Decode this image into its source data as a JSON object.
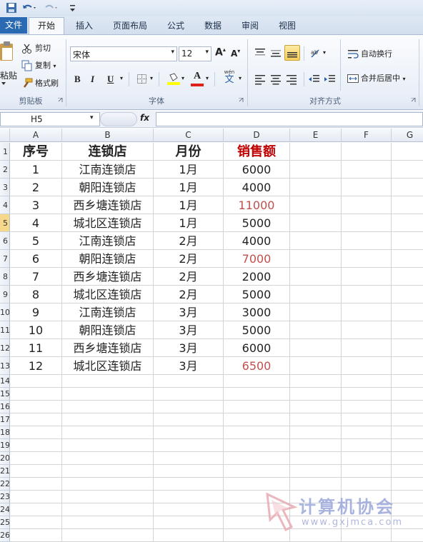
{
  "tabs": {
    "file": "文件",
    "home": "开始",
    "insert": "插入",
    "page_layout": "页面布局",
    "formulas": "公式",
    "data": "数据",
    "review": "审阅",
    "view": "视图"
  },
  "clipboard": {
    "paste": "粘贴",
    "cut": "剪切",
    "copy": "复制",
    "format_painter": "格式刷",
    "group_label": "剪贴板"
  },
  "font": {
    "name": "宋体",
    "size": "12",
    "bold": "B",
    "italic": "I",
    "underline": "U",
    "font_color_glyph": "A",
    "phonetic": "wén",
    "phonetic_char": "文",
    "group_label": "字体"
  },
  "alignment": {
    "wrap_text": "自动换行",
    "merge_center": "合并后居中",
    "group_label": "对齐方式"
  },
  "formula_bar": {
    "name_box": "H5",
    "fx": "fx",
    "formula": ""
  },
  "columns": [
    "A",
    "B",
    "C",
    "D",
    "E",
    "F",
    "G"
  ],
  "row_numbers": [
    "1",
    "2",
    "3",
    "4",
    "5",
    "6",
    "7",
    "8",
    "9",
    "10",
    "11",
    "12",
    "13",
    "14",
    "15",
    "16",
    "17",
    "18",
    "19",
    "20",
    "21",
    "22",
    "23",
    "24",
    "25",
    "26"
  ],
  "selected_row": "5",
  "sheet": {
    "headers": {
      "a": "序号",
      "b": "连锁店",
      "c": "月份",
      "d": "销售额"
    },
    "rows": [
      {
        "a": "1",
        "b": "江南连锁店",
        "c": "1月",
        "d": "6000",
        "d_highlight": false
      },
      {
        "a": "2",
        "b": "朝阳连锁店",
        "c": "1月",
        "d": "4000",
        "d_highlight": false
      },
      {
        "a": "3",
        "b": "西乡塘连锁店",
        "c": "1月",
        "d": "11000",
        "d_highlight": true
      },
      {
        "a": "4",
        "b": "城北区连锁店",
        "c": "1月",
        "d": "5000",
        "d_highlight": false
      },
      {
        "a": "5",
        "b": "江南连锁店",
        "c": "2月",
        "d": "4000",
        "d_highlight": false
      },
      {
        "a": "6",
        "b": "朝阳连锁店",
        "c": "2月",
        "d": "7000",
        "d_highlight": true
      },
      {
        "a": "7",
        "b": "西乡塘连锁店",
        "c": "2月",
        "d": "2000",
        "d_highlight": false
      },
      {
        "a": "8",
        "b": "城北区连锁店",
        "c": "2月",
        "d": "5000",
        "d_highlight": false
      },
      {
        "a": "9",
        "b": "江南连锁店",
        "c": "3月",
        "d": "3000",
        "d_highlight": false
      },
      {
        "a": "10",
        "b": "朝阳连锁店",
        "c": "3月",
        "d": "5000",
        "d_highlight": false
      },
      {
        "a": "11",
        "b": "西乡塘连锁店",
        "c": "3月",
        "d": "6000",
        "d_highlight": false
      },
      {
        "a": "12",
        "b": "城北区连锁店",
        "c": "3月",
        "d": "6500",
        "d_highlight": true
      }
    ]
  },
  "watermark": {
    "title": "计算机协会",
    "url": "www.gxjmca.com"
  },
  "colors": {
    "header_red": "#c00000",
    "highlight_red": "#c0504d",
    "file_tab": "#2a6ab3",
    "selected_row_header": "#f7d88b"
  }
}
